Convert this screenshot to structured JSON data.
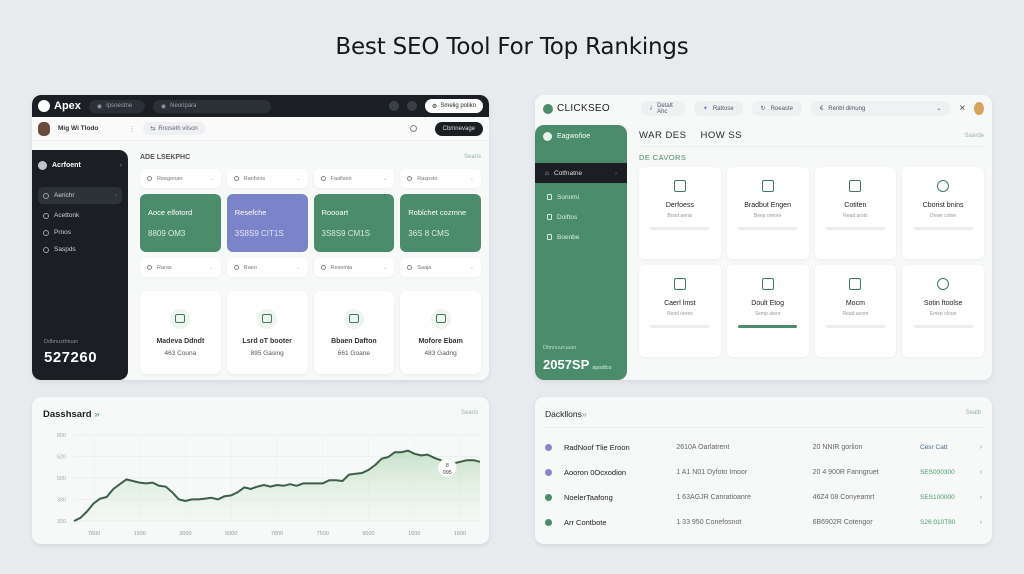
{
  "title": "Best SEO Tool For Top Rankings",
  "apex": {
    "brand": "Apex",
    "top_pills": [
      "Ipsoestne",
      "Neoripara"
    ],
    "top_action": "Smelig polikn",
    "user_name": "Mig Wi Tlodo",
    "sub_pill": "Rnoseth vilson",
    "sub_button": "Cbmnevage",
    "sidebar": {
      "header": "Acrfoent",
      "items": [
        {
          "label": "Aerichr",
          "active": true
        },
        {
          "label": "Acettonk",
          "active": false
        },
        {
          "label": "Prnos",
          "active": false
        },
        {
          "label": "Saspds",
          "active": false
        }
      ],
      "footer_label": "Ddbnusthtuan",
      "footer_value": "527260"
    },
    "section_title": "ADE LSEKPHC",
    "section_link": "Searis",
    "filters_top": [
      "Reegenan",
      "Ranfsios",
      "Faafisen",
      "Raspsto"
    ],
    "stats": [
      {
        "title": "Aoce elfotord",
        "value": "8809 OM3",
        "color": "#4a8c6b"
      },
      {
        "title": "Resefche",
        "value": "3S8S9 CIT1S",
        "color": "#7b84c8"
      },
      {
        "title": "Roooart",
        "value": "3S8S9 CM1S",
        "color": "#4a8c6b"
      },
      {
        "title": "Roblchet cozmne",
        "value": "36S 8 CMS",
        "color": "#4a8c6b"
      }
    ],
    "filters_bottom": [
      "Raras",
      "Raeo",
      "Resemia",
      "Saaja"
    ],
    "cards": [
      {
        "name": "Madeva Ddndt",
        "sub": "463 Couna"
      },
      {
        "name": "Lsrd oT booter",
        "sub": "895 Gasing"
      },
      {
        "name": "Bbaen Dafton",
        "sub": "661 Goane"
      },
      {
        "name": "Mofore Ebam",
        "sub": "483 Gadng"
      }
    ]
  },
  "clickseo": {
    "brand": "CLICKSEO",
    "top_pills": [
      "Detalt Ahc",
      "Rattose",
      "Roeaste"
    ],
    "select_value": "Renbl dimung",
    "close_label": "×",
    "sidebar": {
      "header": "Eagwoñoe",
      "active_item": "Cotfnatne",
      "items": [
        "Sonnmi",
        "Doiftos",
        "Boenbe"
      ],
      "footer_label": "Dbnnuuruaan",
      "footer_value": "2057SP",
      "footer_unit": "apodico"
    },
    "tabs": [
      "WAR DES",
      "HOW SS"
    ],
    "tabs_link": "Saarde",
    "section_title": "DE CAVORS",
    "cards": [
      {
        "name": "Derfoess",
        "sub": "Bood aenis",
        "progress": 0,
        "icon": "server-icon"
      },
      {
        "name": "Bradbut Engen",
        "sub": "Beep oreore",
        "progress": 0,
        "icon": "server-icon"
      },
      {
        "name": "Cotiten",
        "sub": "Read arots",
        "progress": 0,
        "icon": "document-icon"
      },
      {
        "name": "Cborist bnins",
        "sub": "Dnwe coloe",
        "progress": 0,
        "icon": "disc-icon"
      },
      {
        "name": "Caerl lmst",
        "sub": "Rend oeres",
        "progress": 0,
        "icon": "browser-icon"
      },
      {
        "name": "Doult Etog",
        "sub": "Semp ateor",
        "progress": 100,
        "icon": "calendar-icon"
      },
      {
        "name": "Mocm",
        "sub": "Read aeom",
        "progress": 0,
        "icon": "monitor-icon"
      },
      {
        "name": "Sotin ftoolse",
        "sub": "Emep olooe",
        "progress": 0,
        "icon": "disc-icon"
      }
    ]
  },
  "dashboard_chart": {
    "title": "Dasshsard",
    "title_suffix": "»",
    "link": "Searis",
    "tooltip": {
      "line1": "8",
      "line2": "095"
    },
    "chart_data": {
      "type": "area",
      "title": "Dasshsard",
      "xlabel": "",
      "ylabel": "",
      "y_ticks": [
        "300",
        "300",
        "500",
        "520",
        "800"
      ],
      "x_ticks": [
        "7600",
        "1900",
        "3000",
        "5000",
        "7800",
        "7500",
        "9000",
        "1600",
        "1600"
      ],
      "ylim": [
        0,
        100
      ],
      "values": [
        0,
        4,
        12,
        22,
        28,
        30,
        40,
        46,
        52,
        50,
        48,
        47,
        48,
        44,
        43,
        36,
        27,
        25,
        27,
        27,
        28,
        29,
        27,
        31,
        32,
        36,
        42,
        40,
        43,
        45,
        43,
        45,
        44,
        46,
        44,
        47,
        47,
        47,
        47,
        51,
        51,
        50,
        58,
        59,
        60,
        64,
        70,
        78,
        80,
        86,
        86,
        88,
        84,
        82,
        83,
        79,
        76,
        74,
        72,
        74,
        76,
        76,
        74
      ],
      "grid": true
    }
  },
  "backlinks": {
    "title": "Dackllons",
    "title_suffix": "»",
    "link": "Sealb",
    "rows": [
      {
        "name": "RadNoof Tlie Eroon",
        "c2": "2610A Oarlatrent",
        "c3": "20 NNIR gorlion",
        "c4": "Cesr Catt",
        "dot": "#8a86c8",
        "c4color": "#4a6c8c"
      },
      {
        "name": "Aooron 0Ocxodion",
        "c2": "1 A1 N01 Dyfoto Imoor",
        "c3": "20 4 900R Fanngruet",
        "c4": "SES000300",
        "dot": "#8a86c8",
        "c4color": "#4a9c6b"
      },
      {
        "name": "NoelerTaafong",
        "c2": "1 63AGJR Canratioanre",
        "c3": "46Z4 08 Conyeamrt",
        "c4": "SES100000",
        "dot": "#4a8c6b",
        "c4color": "#4a9c6b"
      },
      {
        "name": "Arr Contbote",
        "c2": "1 33 950 Conefosnot",
        "c3": "6B6902R Cotengor",
        "c4": "S26 010T80",
        "dot": "#4a8c6b",
        "c4color": "#4a9c6b"
      }
    ]
  }
}
